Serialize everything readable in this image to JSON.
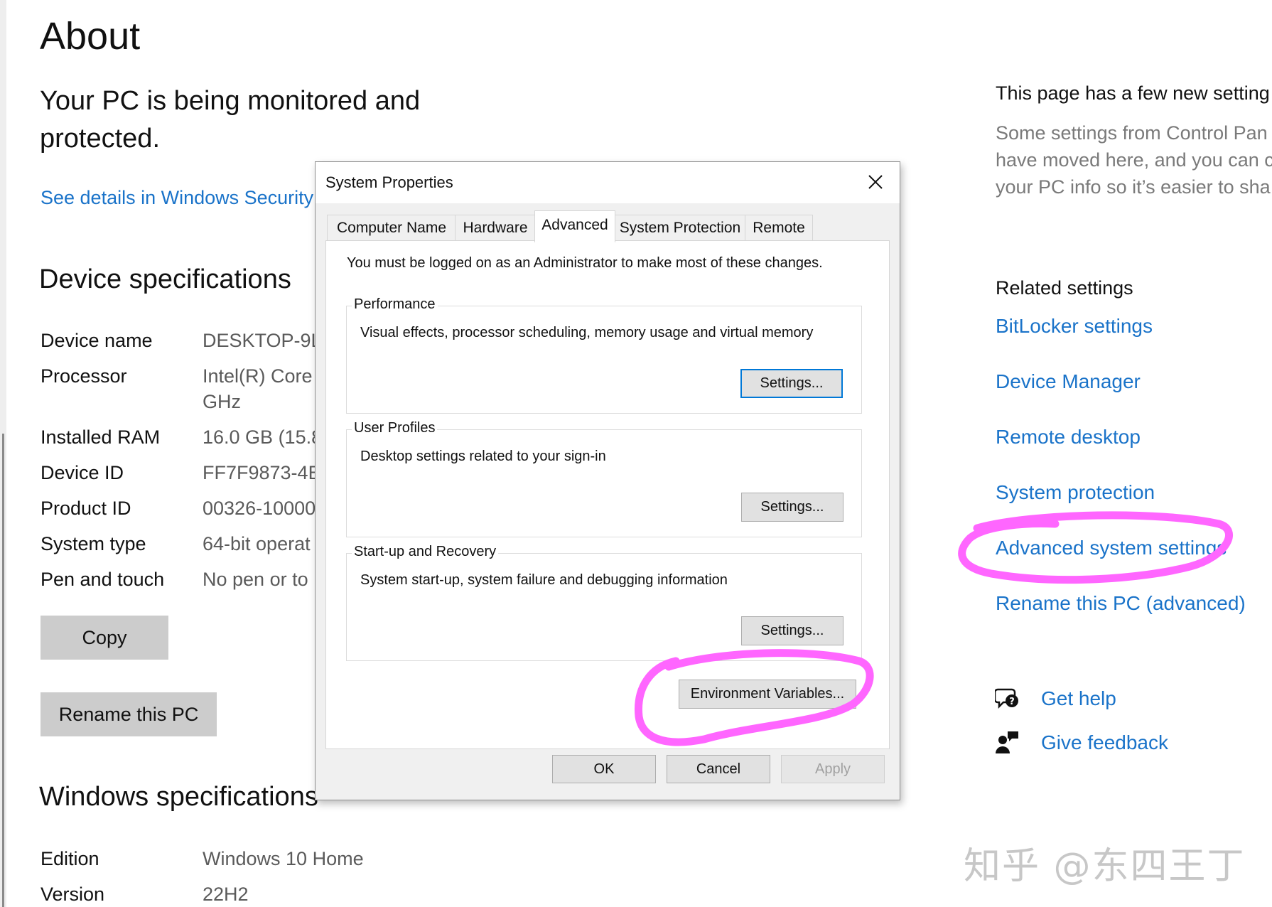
{
  "about": {
    "title": "About",
    "protection_text": "Your PC is being monitored and protected.",
    "security_link": "See details in Windows Security"
  },
  "device_specs": {
    "title": "Device specifications",
    "rows": [
      {
        "label": "Device name",
        "value": "DESKTOP-9L"
      },
      {
        "label": "Processor",
        "value": "Intel(R) Core",
        "value2": "GHz"
      },
      {
        "label": "Installed RAM",
        "value": "16.0 GB (15.8"
      },
      {
        "label": "Device ID",
        "value": "FF7F9873-4B"
      },
      {
        "label": "Product ID",
        "value": "00326-10000"
      },
      {
        "label": "System type",
        "value": "64-bit operat"
      },
      {
        "label": "Pen and touch",
        "value": "No pen or to"
      }
    ],
    "copy_button": "Copy",
    "rename_button": "Rename this PC"
  },
  "windows_specs": {
    "title": "Windows specifications",
    "rows": [
      {
        "label": "Edition",
        "value": "Windows 10 Home"
      },
      {
        "label": "Version",
        "value": "22H2"
      }
    ]
  },
  "right_panel": {
    "new_settings_title": "This page has a few new setting",
    "new_settings_text": [
      "Some settings from Control Pan",
      "have moved here, and you can c",
      "your PC info so it’s easier to sha"
    ],
    "related_title": "Related settings",
    "related_links": [
      "BitLocker settings",
      "Device Manager",
      "Remote desktop",
      "System protection",
      "Advanced system settings",
      "Rename this PC (advanced)"
    ],
    "help_link": "Get help",
    "feedback_link": "Give feedback"
  },
  "dialog": {
    "title": "System Properties",
    "tabs": [
      "Computer Name",
      "Hardware",
      "Advanced",
      "System Protection",
      "Remote"
    ],
    "active_tab": "Advanced",
    "admin_note": "You must be logged on as an Administrator to make most of these changes.",
    "groups": [
      {
        "legend": "Performance",
        "description": "Visual effects, processor scheduling, memory usage and virtual memory",
        "button": "Settings..."
      },
      {
        "legend": "User Profiles",
        "description": "Desktop settings related to your sign-in",
        "button": "Settings..."
      },
      {
        "legend": "Start-up and Recovery",
        "description": "System start-up, system failure and debugging information",
        "button": "Settings..."
      }
    ],
    "env_button": "Environment Variables...",
    "ok": "OK",
    "cancel": "Cancel",
    "apply": "Apply"
  },
  "watermark": "知乎 @东四王丁",
  "colors": {
    "link": "#1a73c9",
    "highlight": "#ff66ff",
    "focus_border": "#0078d7"
  },
  "icons": [
    "close-icon",
    "help-icon",
    "feedback-icon"
  ]
}
